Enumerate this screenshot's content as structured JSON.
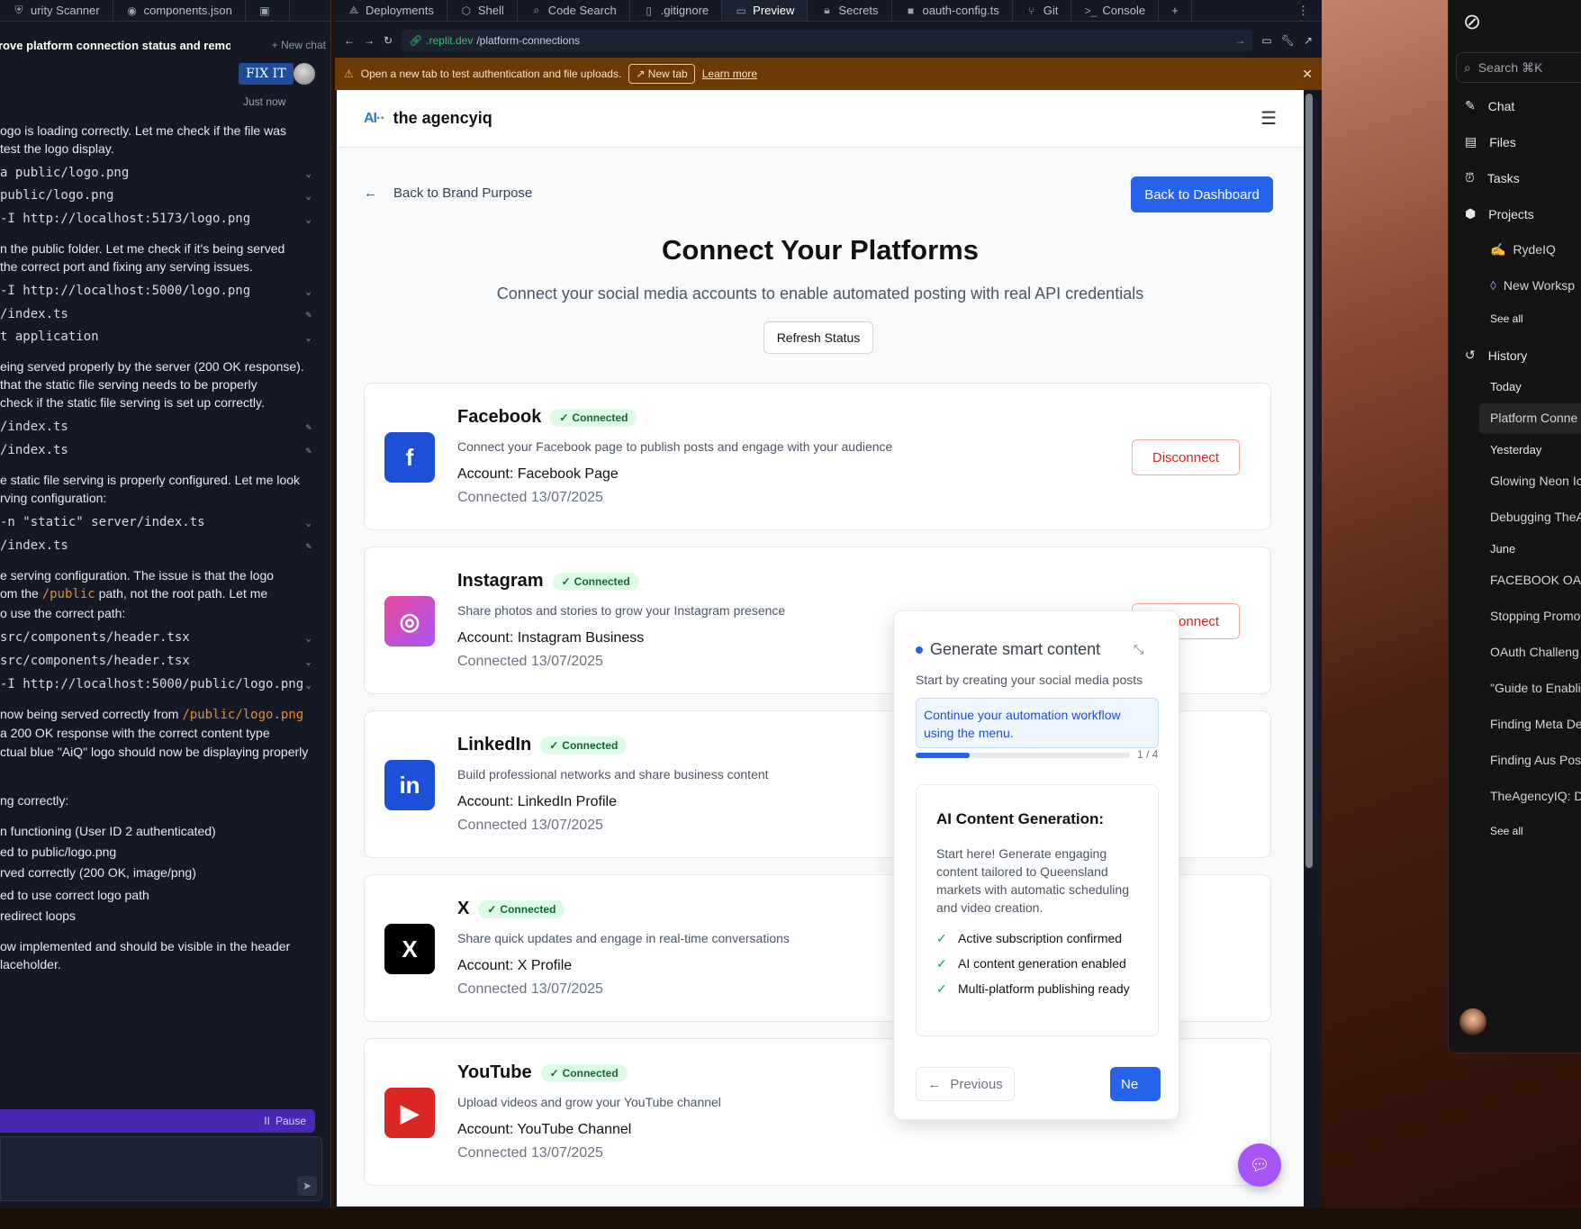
{
  "agent": {
    "tabs": [
      {
        "label": "urity Scanner",
        "icon": "shield-icon"
      },
      {
        "label": "components.json",
        "icon": "json-file-icon"
      },
      {
        "label": "",
        "icon": "html-file-icon"
      }
    ],
    "chat_title": "rove platform connection status and remove...",
    "new_chat_label": "+ New chat",
    "user_message": "FIX IT",
    "timestamp": "Just now",
    "lines": [
      {
        "type": "text",
        "text": "ogo is loading correctly. Let me check if the file was"
      },
      {
        "type": "text",
        "text": " test the logo display."
      },
      {
        "type": "cmd",
        "text": "a public/logo.png",
        "icon": "chevron-down-icon"
      },
      {
        "type": "cmd",
        "text": "public/logo.png",
        "icon": "chevron-down-icon"
      },
      {
        "type": "cmd",
        "text": "-I http://localhost:5173/logo.png",
        "icon": "chevron-down-icon"
      },
      {
        "type": "text",
        "text": "n the public folder. Let me check if it's being served"
      },
      {
        "type": "text",
        "text": "the correct port and fixing any serving issues."
      },
      {
        "type": "cmd",
        "text": "-I http://localhost:5000/logo.png",
        "icon": "chevron-down-icon"
      },
      {
        "type": "cmd",
        "text": "/index.ts",
        "icon": "edit-icon"
      },
      {
        "type": "cmd",
        "text": "t application",
        "icon": "chevron-down-icon"
      },
      {
        "type": "text",
        "text": "eing served properly by the server (200 OK response)."
      },
      {
        "type": "text",
        "text": "that the static file serving needs to be properly"
      },
      {
        "type": "text",
        "text": "check if the static file serving is set up correctly."
      },
      {
        "type": "cmd",
        "text": "/index.ts",
        "icon": "edit-icon"
      },
      {
        "type": "cmd",
        "text": "/index.ts",
        "icon": "edit-icon"
      },
      {
        "type": "text",
        "text": "e static file serving is properly configured. Let me look"
      },
      {
        "type": "text",
        "text": "rving configuration:"
      },
      {
        "type": "cmd",
        "text": "-n \"static\" server/index.ts",
        "icon": "chevron-down-icon"
      },
      {
        "type": "cmd",
        "text": "/index.ts",
        "icon": "edit-icon"
      },
      {
        "type": "text",
        "text": "e serving configuration. The issue is that the logo"
      },
      {
        "type": "text2",
        "pre": "om the ",
        "code": "/public",
        "post": " path, not the root path. Let me"
      },
      {
        "type": "text",
        "text": "o use the correct path:"
      },
      {
        "type": "cmd",
        "text": "src/components/header.tsx",
        "icon": "chevron-down-icon"
      },
      {
        "type": "cmd",
        "text": "src/components/header.tsx",
        "icon": "chevron-down-icon"
      },
      {
        "type": "cmd",
        "text": "-I http://localhost:5000/public/logo.png",
        "icon": "chevron-down-icon"
      },
      {
        "type": "text2",
        "pre": "now being served correctly from ",
        "code": "/public/logo.png",
        "post": ""
      },
      {
        "type": "text",
        "text": "a 200 OK response with the correct content type"
      },
      {
        "type": "text",
        "text": "ctual blue \"AiQ\" logo should now be displaying properly"
      },
      {
        "type": "text",
        "text": "ng correctly:"
      },
      {
        "type": "text",
        "text": "n functioning (User ID 2 authenticated)"
      },
      {
        "type": "text",
        "text": "ed to public/logo.png"
      },
      {
        "type": "text",
        "text": "rved correctly (200 OK, image/png)"
      },
      {
        "type": "text",
        "text": "ed to use correct logo path"
      },
      {
        "type": "text",
        "text": " redirect loops"
      },
      {
        "type": "text",
        "text": "ow implemented and should be visible in the header"
      },
      {
        "type": "text",
        "text": "laceholder."
      }
    ],
    "pause_label": "Pause"
  },
  "browser": {
    "tabs": [
      {
        "label": "Deployments",
        "icon": "deployments-icon"
      },
      {
        "label": "Shell",
        "icon": "shell-icon"
      },
      {
        "label": "Code Search",
        "icon": "search-icon"
      },
      {
        "label": ".gitignore",
        "icon": "file-icon"
      },
      {
        "label": "Preview",
        "icon": "monitor-icon",
        "active": true
      },
      {
        "label": "Secrets",
        "icon": "lock-icon"
      },
      {
        "label": "oauth-config.ts",
        "icon": "ts-file-icon"
      },
      {
        "label": "Git",
        "icon": "git-icon"
      },
      {
        "label": "Console",
        "icon": "terminal-icon"
      }
    ],
    "url_domain": ".replit.dev",
    "url_path": "/platform-connections",
    "banner_text": "Open a new tab to test authentication and file uploads.",
    "banner_button": "New tab",
    "banner_link": "Learn more"
  },
  "app": {
    "logo_mark": "AI··",
    "brand": "the agencyiq",
    "back_link": "Back to Brand Purpose",
    "dashboard_button": "Back to Dashboard",
    "title": "Connect Your Platforms",
    "subtitle": "Connect your social media accounts to enable automated posting with real API credentials",
    "refresh_button": "Refresh Status",
    "platforms": [
      {
        "name": "Facebook",
        "status": "Connected",
        "desc": "Connect your Facebook page to publish posts and engage with your audience",
        "account": "Account: Facebook Page",
        "date": "Connected 13/07/2025",
        "action": "Disconnect",
        "color": "#1d4fd8",
        "glyph": "f"
      },
      {
        "name": "Instagram",
        "status": "Connected",
        "desc": "Share photos and stories to grow your Instagram presence",
        "account": "Account: Instagram Business",
        "date": "Connected 13/07/2025",
        "action": "Disconnect",
        "color": "#d946ef",
        "glyph": "◎"
      },
      {
        "name": "LinkedIn",
        "status": "Connected",
        "desc": "Build professional networks and share business content",
        "account": "Account: LinkedIn Profile",
        "date": "Connected 13/07/2025",
        "action": "",
        "color": "#1d4fd8",
        "glyph": "in"
      },
      {
        "name": "X",
        "status": "Connected",
        "desc": "Share quick updates and engage in real-time conversations",
        "account": "Account: X Profile",
        "date": "Connected 13/07/2025",
        "action": "",
        "color": "#000000",
        "glyph": "X"
      },
      {
        "name": "YouTube",
        "status": "Connected",
        "desc": "Upload videos and grow your YouTube channel",
        "account": "Account: YouTube Channel",
        "date": "Connected 13/07/2025",
        "action": "",
        "color": "#dc2626",
        "glyph": "▶"
      }
    ],
    "guide": {
      "title": "Generate smart content",
      "subtitle": "Start by creating your social media posts",
      "note": "Continue your automation workflow using the menu.",
      "step": "1 / 4",
      "progress": 0.25,
      "card_title": "AI Content Generation:",
      "card_body": "Start here! Generate engaging content tailored to Queensland markets with automatic scheduling and video creation.",
      "checks": [
        "Active subscription confirmed",
        "AI content generation enabled",
        "Multi-platform publishing ready"
      ],
      "prev": "Previous",
      "next": "Ne"
    }
  },
  "sidebar": {
    "search": "Search ⌘K",
    "nav": [
      {
        "label": "Chat",
        "icon": "chat-icon"
      },
      {
        "label": "Files",
        "icon": "files-icon"
      },
      {
        "label": "Tasks",
        "icon": "tasks-icon"
      },
      {
        "label": "Projects",
        "icon": "projects-icon"
      }
    ],
    "projects": [
      "RydeIQ",
      "New Worksp"
    ],
    "see_all_1": "See all",
    "history_label": "History",
    "history": [
      {
        "group": "Today",
        "items": [
          "Platform Conne"
        ]
      },
      {
        "group": "Yesterday",
        "items": [
          "Glowing Neon Ic",
          "Debugging TheA"
        ]
      },
      {
        "group": "June",
        "items": [
          "FACEBOOK OA",
          "Stopping Promo",
          "OAuth Challeng",
          "\"Guide to Enabli",
          "Finding Meta De",
          "Finding Aus Pos",
          "TheAgencyIQ: D"
        ]
      }
    ],
    "see_all_2": "See all"
  }
}
